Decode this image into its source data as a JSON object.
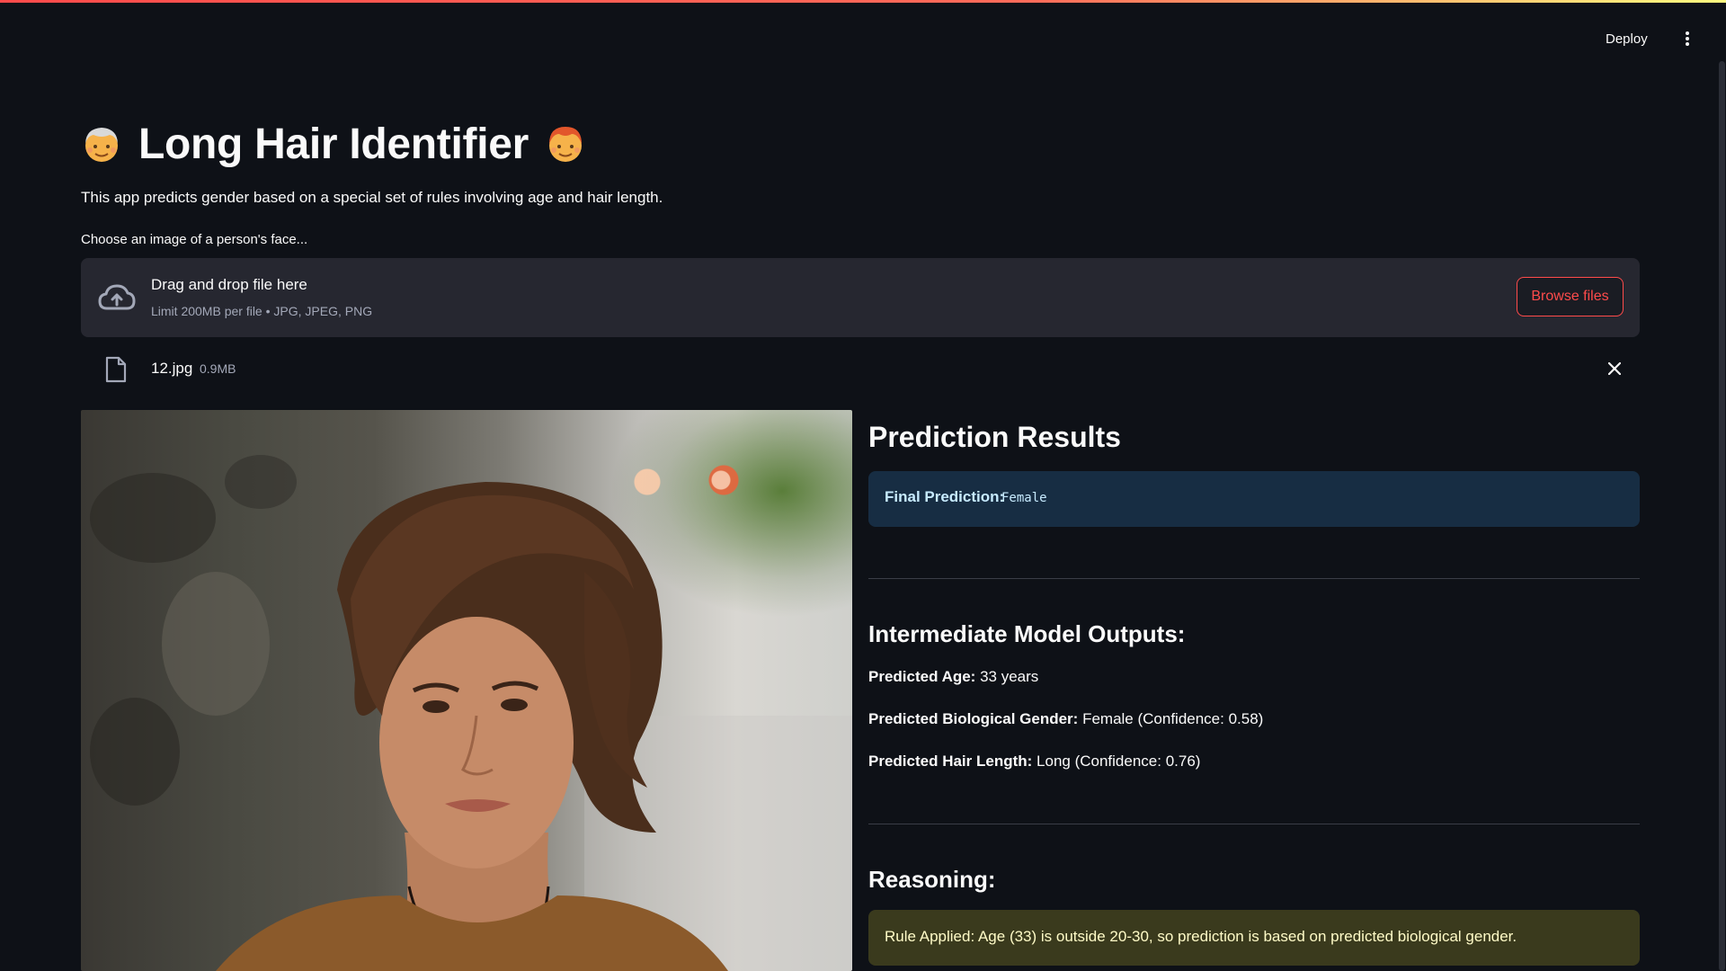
{
  "header": {
    "deploy_label": "Deploy",
    "menu_icon": "kebab-menu-icon"
  },
  "app": {
    "title": "Long Hair Identifier",
    "title_emoji_left": "older-person-emoji",
    "title_emoji_right": "person-red-hair-emoji",
    "description": "This app predicts gender based on a special set of rules involving age and hair length."
  },
  "uploader": {
    "label": "Choose an image of a person's face...",
    "drop_title": "Drag and drop file here",
    "drop_limits": "Limit 200MB per file • JPG, JPEG, PNG",
    "browse_label": "Browse files",
    "icon": "cloud-upload-icon"
  },
  "file": {
    "name": "12.jpg",
    "size": "0.9MB",
    "icon": "file-icon"
  },
  "results": {
    "heading": "Prediction Results",
    "final_label": "Final Prediction:",
    "final_value": "Female",
    "intermediate_heading": "Intermediate Model Outputs:",
    "age_label": "Predicted Age:",
    "age_value": "33 years",
    "gender_label": "Predicted Biological Gender:",
    "gender_value": "Female (Confidence: 0.58)",
    "hair_label": "Predicted Hair Length:",
    "hair_value": "Long (Confidence: 0.76)",
    "reasoning_heading": "Reasoning:",
    "rule_text": "Rule Applied: Age (33) is outside 20-30, so prediction is based on predicted biological gender."
  },
  "colors": {
    "background": "#0e1117",
    "accent": "#ff4b4b",
    "info_bg": "#172d43",
    "warning_bg": "#3a3a1d"
  }
}
